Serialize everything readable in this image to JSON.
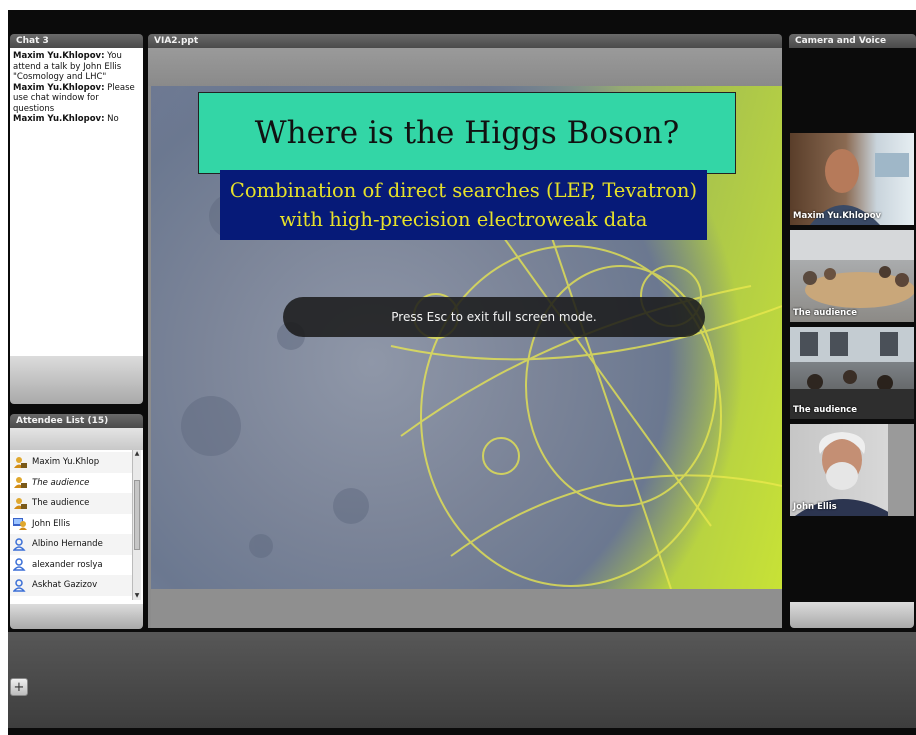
{
  "chat": {
    "title": "Chat 3",
    "messages": [
      {
        "sender": "Maxim Yu.Khlopov:",
        "text": " You attend a talk by John Ellis \"Cosmology and LHC\""
      },
      {
        "sender": "Maxim Yu.Khlopov:",
        "text": " Please use chat window for questions"
      },
      {
        "sender": "Maxim Yu.Khlopov:",
        "text": " No"
      }
    ]
  },
  "attendees": {
    "title": "Attendee List (15)",
    "items": [
      {
        "name": "Maxim Yu.Khlop",
        "icon": "presenter-icon",
        "italic": false
      },
      {
        "name": "The audience",
        "icon": "presenter-icon",
        "italic": true
      },
      {
        "name": "The audience",
        "icon": "presenter-icon",
        "italic": false
      },
      {
        "name": "John Ellis",
        "icon": "host-icon",
        "italic": false
      },
      {
        "name": "Albino Hernande",
        "icon": "user-icon",
        "italic": false
      },
      {
        "name": "alexander roslya",
        "icon": "user-icon",
        "italic": false
      },
      {
        "name": "Askhat Gazizov",
        "icon": "user-icon",
        "italic": false
      }
    ]
  },
  "slide": {
    "title": "VIA2.ppt",
    "heading": "Where is the Higgs Boson?",
    "sub_line1": "Combination of direct searches (LEP, Tevatron)",
    "sub_line2": "with high-precision electroweak data"
  },
  "fullscreen": {
    "message": "Press Esc to exit full screen mode."
  },
  "camera": {
    "title": "Camera and Voice",
    "feeds": [
      {
        "name": "Maxim Yu.Khlopov"
      },
      {
        "name": "The audience"
      },
      {
        "name": "The audience"
      },
      {
        "name": "John Ellis"
      }
    ]
  },
  "toolbar": {
    "add_label": "+"
  },
  "colors": {
    "title_box": "#33d6a6",
    "subtitle_box": "#061a78",
    "subtitle_text": "#e6e12a"
  }
}
